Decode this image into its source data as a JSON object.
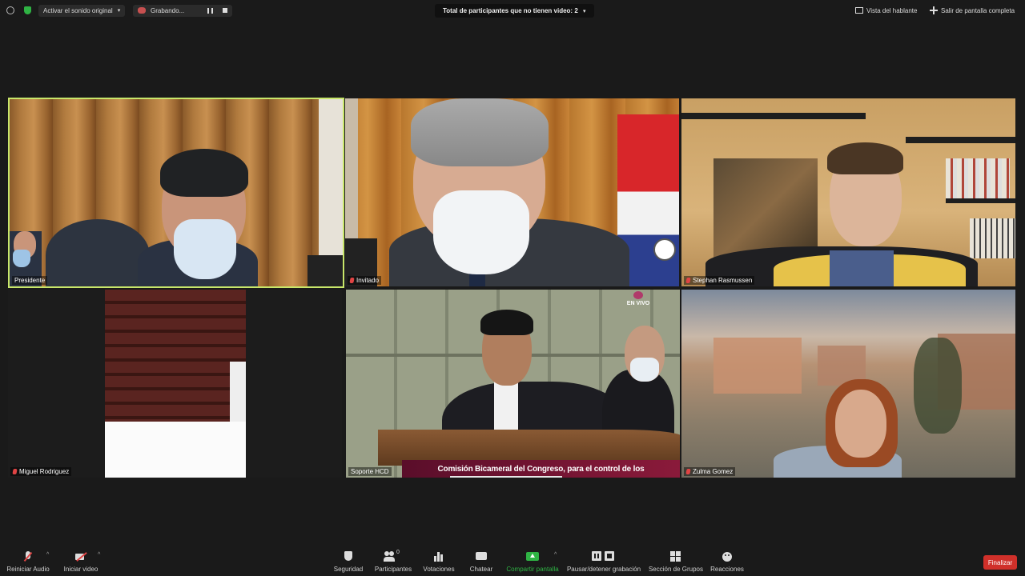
{
  "topbar": {
    "audio_label": "Activar el sonido original",
    "recording_label": "Grabando...",
    "participants_no_video": "Total de participantes que no tienen video: 2",
    "speaker_view_label": "Vista del hablante",
    "exit_fullscreen_label": "Salir de pantalla completa"
  },
  "tiles": [
    {
      "name": "Presidente",
      "muted": false,
      "active": true
    },
    {
      "name": "Invitado",
      "muted": true,
      "active": false
    },
    {
      "name": "Stephan Rasmussen",
      "muted": true,
      "active": false
    },
    {
      "name": "Miguel Rodriguez",
      "muted": true,
      "active": false
    },
    {
      "name": "Soporte HCD",
      "muted": false,
      "active": false
    },
    {
      "name": "Zulma Gomez",
      "muted": true,
      "active": false
    }
  ],
  "broadcast": {
    "channel_label": "EN VIVO",
    "caption": "Comisión Bicameral del Congreso, para el control de los"
  },
  "toolbar": {
    "audio": "Reiniciar Audio",
    "video": "Iniciar video",
    "security": "Seguridad",
    "participants": "Participantes",
    "participants_count": "0",
    "polls": "Votaciones",
    "chat": "Chatear",
    "share": "Compartir pantalla",
    "pause_recording": "Pausar/detener grabación",
    "breakout": "Sección de Grupos",
    "reactions": "Reacciones",
    "end": "Finalizar"
  },
  "icons": [
    "info-icon",
    "shield-icon",
    "cloud-record-icon",
    "pause-icon",
    "stop-icon",
    "chevron-down-icon",
    "grid-view-icon",
    "exit-fullscreen-icon",
    "mic-muted-icon",
    "video-off-icon",
    "security-icon",
    "participants-icon",
    "polls-icon",
    "chat-icon",
    "share-screen-icon",
    "breakout-icon",
    "reactions-icon"
  ],
  "colors": {
    "active_speaker_border": "#c8e66a",
    "share_green": "#2fb344",
    "end_red": "#d0302a",
    "muted_red": "#e04444"
  }
}
